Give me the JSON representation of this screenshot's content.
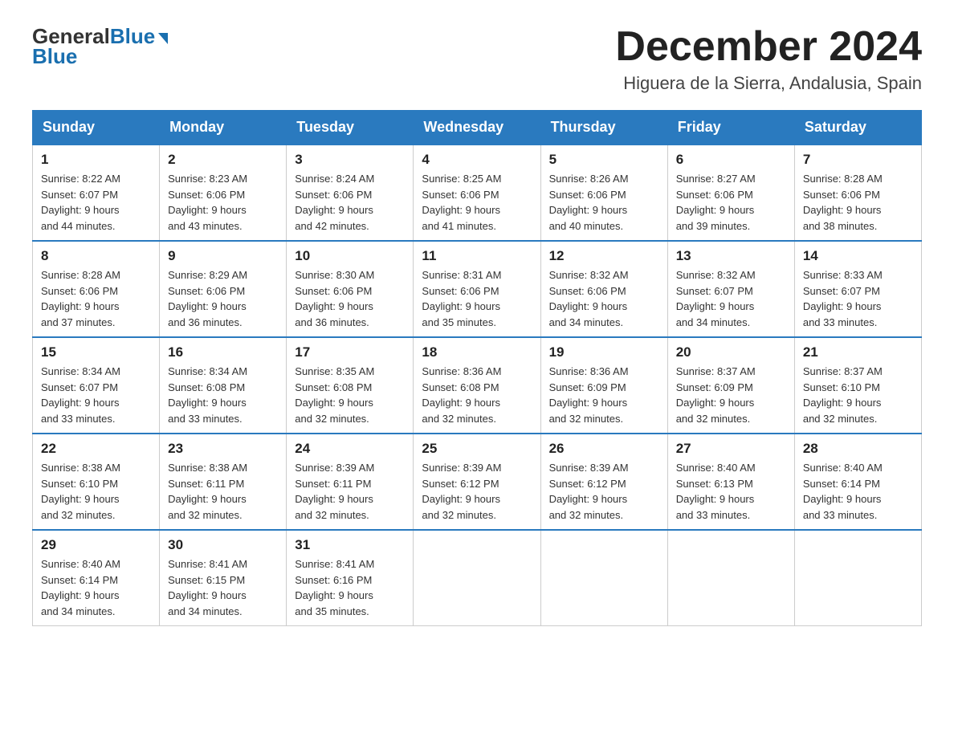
{
  "header": {
    "logo_general": "General",
    "logo_blue": "Blue",
    "month_title": "December 2024",
    "location": "Higuera de la Sierra, Andalusia, Spain"
  },
  "days_of_week": [
    "Sunday",
    "Monday",
    "Tuesday",
    "Wednesday",
    "Thursday",
    "Friday",
    "Saturday"
  ],
  "weeks": [
    [
      {
        "day": "1",
        "sunrise": "8:22 AM",
        "sunset": "6:07 PM",
        "daylight": "9 hours and 44 minutes."
      },
      {
        "day": "2",
        "sunrise": "8:23 AM",
        "sunset": "6:06 PM",
        "daylight": "9 hours and 43 minutes."
      },
      {
        "day": "3",
        "sunrise": "8:24 AM",
        "sunset": "6:06 PM",
        "daylight": "9 hours and 42 minutes."
      },
      {
        "day": "4",
        "sunrise": "8:25 AM",
        "sunset": "6:06 PM",
        "daylight": "9 hours and 41 minutes."
      },
      {
        "day": "5",
        "sunrise": "8:26 AM",
        "sunset": "6:06 PM",
        "daylight": "9 hours and 40 minutes."
      },
      {
        "day": "6",
        "sunrise": "8:27 AM",
        "sunset": "6:06 PM",
        "daylight": "9 hours and 39 minutes."
      },
      {
        "day": "7",
        "sunrise": "8:28 AM",
        "sunset": "6:06 PM",
        "daylight": "9 hours and 38 minutes."
      }
    ],
    [
      {
        "day": "8",
        "sunrise": "8:28 AM",
        "sunset": "6:06 PM",
        "daylight": "9 hours and 37 minutes."
      },
      {
        "day": "9",
        "sunrise": "8:29 AM",
        "sunset": "6:06 PM",
        "daylight": "9 hours and 36 minutes."
      },
      {
        "day": "10",
        "sunrise": "8:30 AM",
        "sunset": "6:06 PM",
        "daylight": "9 hours and 36 minutes."
      },
      {
        "day": "11",
        "sunrise": "8:31 AM",
        "sunset": "6:06 PM",
        "daylight": "9 hours and 35 minutes."
      },
      {
        "day": "12",
        "sunrise": "8:32 AM",
        "sunset": "6:06 PM",
        "daylight": "9 hours and 34 minutes."
      },
      {
        "day": "13",
        "sunrise": "8:32 AM",
        "sunset": "6:07 PM",
        "daylight": "9 hours and 34 minutes."
      },
      {
        "day": "14",
        "sunrise": "8:33 AM",
        "sunset": "6:07 PM",
        "daylight": "9 hours and 33 minutes."
      }
    ],
    [
      {
        "day": "15",
        "sunrise": "8:34 AM",
        "sunset": "6:07 PM",
        "daylight": "9 hours and 33 minutes."
      },
      {
        "day": "16",
        "sunrise": "8:34 AM",
        "sunset": "6:08 PM",
        "daylight": "9 hours and 33 minutes."
      },
      {
        "day": "17",
        "sunrise": "8:35 AM",
        "sunset": "6:08 PM",
        "daylight": "9 hours and 32 minutes."
      },
      {
        "day": "18",
        "sunrise": "8:36 AM",
        "sunset": "6:08 PM",
        "daylight": "9 hours and 32 minutes."
      },
      {
        "day": "19",
        "sunrise": "8:36 AM",
        "sunset": "6:09 PM",
        "daylight": "9 hours and 32 minutes."
      },
      {
        "day": "20",
        "sunrise": "8:37 AM",
        "sunset": "6:09 PM",
        "daylight": "9 hours and 32 minutes."
      },
      {
        "day": "21",
        "sunrise": "8:37 AM",
        "sunset": "6:10 PM",
        "daylight": "9 hours and 32 minutes."
      }
    ],
    [
      {
        "day": "22",
        "sunrise": "8:38 AM",
        "sunset": "6:10 PM",
        "daylight": "9 hours and 32 minutes."
      },
      {
        "day": "23",
        "sunrise": "8:38 AM",
        "sunset": "6:11 PM",
        "daylight": "9 hours and 32 minutes."
      },
      {
        "day": "24",
        "sunrise": "8:39 AM",
        "sunset": "6:11 PM",
        "daylight": "9 hours and 32 minutes."
      },
      {
        "day": "25",
        "sunrise": "8:39 AM",
        "sunset": "6:12 PM",
        "daylight": "9 hours and 32 minutes."
      },
      {
        "day": "26",
        "sunrise": "8:39 AM",
        "sunset": "6:12 PM",
        "daylight": "9 hours and 32 minutes."
      },
      {
        "day": "27",
        "sunrise": "8:40 AM",
        "sunset": "6:13 PM",
        "daylight": "9 hours and 33 minutes."
      },
      {
        "day": "28",
        "sunrise": "8:40 AM",
        "sunset": "6:14 PM",
        "daylight": "9 hours and 33 minutes."
      }
    ],
    [
      {
        "day": "29",
        "sunrise": "8:40 AM",
        "sunset": "6:14 PM",
        "daylight": "9 hours and 34 minutes."
      },
      {
        "day": "30",
        "sunrise": "8:41 AM",
        "sunset": "6:15 PM",
        "daylight": "9 hours and 34 minutes."
      },
      {
        "day": "31",
        "sunrise": "8:41 AM",
        "sunset": "6:16 PM",
        "daylight": "9 hours and 35 minutes."
      },
      null,
      null,
      null,
      null
    ]
  ],
  "labels": {
    "sunrise": "Sunrise:",
    "sunset": "Sunset:",
    "daylight": "Daylight:"
  }
}
